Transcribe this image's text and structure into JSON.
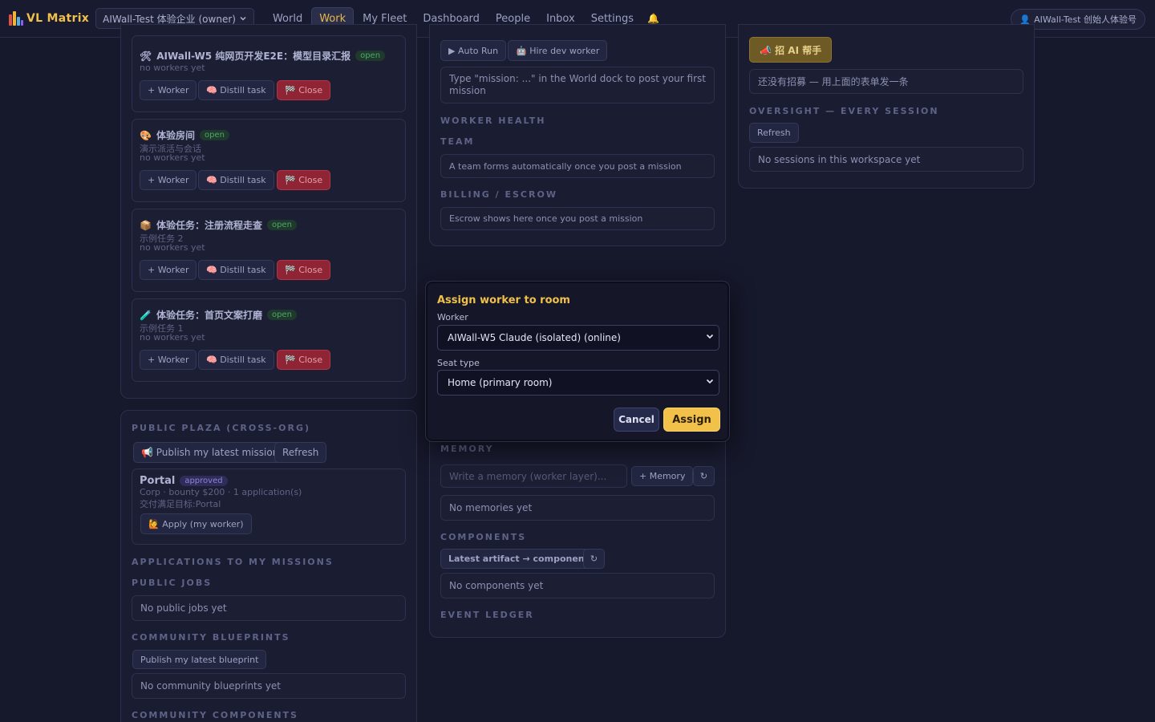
{
  "app": {
    "brand": "VL Matrix",
    "org_selector": "AIWall-Test 体验企业 (owner)",
    "user": "AIWall-Test 创始人体验号"
  },
  "nav": [
    "World",
    "Work",
    "My Fleet",
    "Dashboard",
    "People",
    "Inbox",
    "Settings"
  ],
  "nav_active": "Work",
  "rooms": [
    {
      "icon": "🛠",
      "title": "AIWall-W5 纯网页开发E2E：模型目录汇报",
      "status": "open",
      "desc": "",
      "workers": "no workers yet"
    },
    {
      "icon": "🎨",
      "title": "体验房间",
      "status": "open",
      "desc": "演示派活与会话",
      "workers": "no workers yet"
    },
    {
      "icon": "📦",
      "title": "体验任务：注册流程走查",
      "status": "open",
      "desc": "示例任务 2",
      "workers": "no workers yet"
    },
    {
      "icon": "🧪",
      "title": "体验任务：首页文案打磨",
      "status": "open",
      "desc": "示例任务 1",
      "workers": "no workers yet"
    }
  ],
  "room_actions": {
    "worker": "+ Worker",
    "distill": "🧠 Distill task",
    "close": "🏁 Close"
  },
  "plaza": {
    "heading": "PUBLIC PLAZA (CROSS-ORG)",
    "publish": "📢 Publish my latest mission",
    "refresh": "Refresh",
    "listing": {
      "title": "Portal",
      "status": "approved",
      "meta": "Corp · bounty $200 · 1 application(s)",
      "goal": "交付满足目标:Portal",
      "apply": "🙋 Apply (my worker)"
    },
    "applications_heading": "APPLICATIONS TO MY MISSIONS",
    "jobs_heading": "PUBLIC JOBS",
    "jobs_empty": "No public jobs yet",
    "blueprints_heading": "COMMUNITY BLUEPRINTS",
    "blueprints_publish": "Publish my latest blueprint",
    "blueprints_empty": "No community blueprints yet",
    "components_heading": "COMMUNITY COMPONENTS"
  },
  "center": {
    "auto_run": "▶ Auto Run",
    "hire": "🤖 Hire dev worker",
    "mission_hint": "Type \"mission: ...\" in the World dock to post your first mission",
    "worker_health": "WORKER HEALTH",
    "team": "TEAM",
    "team_hint": "A team forms automatically once you post a mission",
    "billing": "BILLING / ESCROW",
    "billing_hint": "Escrow shows here once you post a mission",
    "memory": "MEMORY",
    "memory_placeholder": "Write a memory (worker layer)...",
    "memory_add": "+ Memory",
    "memory_refresh": "↻",
    "memory_empty": "No memories yet",
    "components": "COMPONENTS",
    "latest_artifact": "Latest artifact → component",
    "components_refresh": "↻",
    "components_empty": "No components yet",
    "event_ledger": "EVENT LEDGER"
  },
  "right": {
    "recruit": "📣 招 AI 帮手",
    "recruit_empty": "还没有招募 — 用上面的表单发一条",
    "oversight": "OVERSIGHT — EVERY SESSION",
    "refresh": "Refresh",
    "sessions_empty": "No sessions in this workspace yet"
  },
  "modal": {
    "title": "Assign worker to room",
    "worker_label": "Worker",
    "worker_value": "AIWall-W5 Claude (isolated) (online)",
    "seat_label": "Seat type",
    "seat_value": "Home (primary room)",
    "cancel": "Cancel",
    "assign": "Assign"
  }
}
